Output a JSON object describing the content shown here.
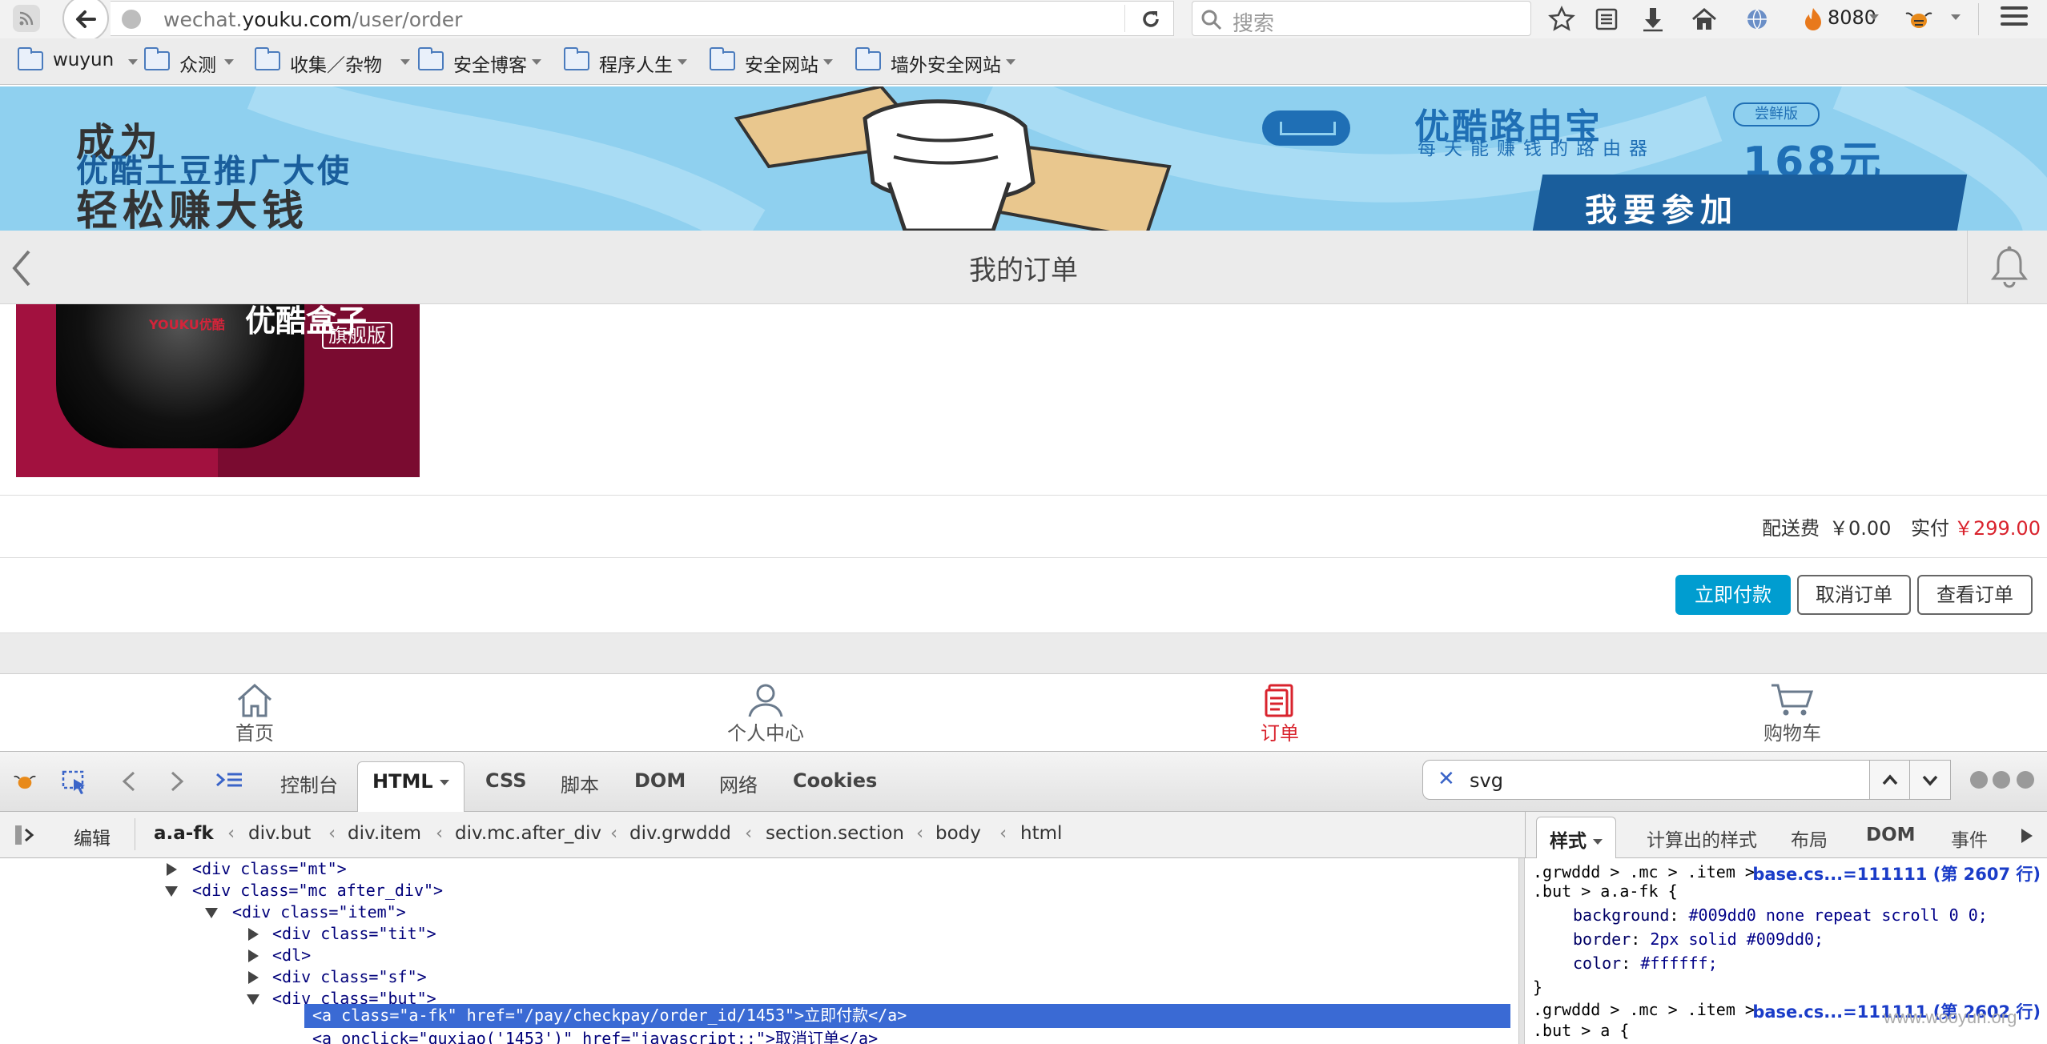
{
  "browser": {
    "url_domain": "wechat.",
    "url_host": "youku.com",
    "url_path": "/user/order",
    "search_placeholder": "搜索",
    "proxy_port": "8080"
  },
  "bookmarks": [
    {
      "label": "wuyun"
    },
    {
      "label": "众测"
    },
    {
      "label": "收集／杂物"
    },
    {
      "label": "安全博客"
    },
    {
      "label": "程序人生"
    },
    {
      "label": "安全网站"
    },
    {
      "label": "墙外安全网站"
    }
  ],
  "banner": {
    "line1": "成为",
    "line2": "优酷土豆推广大使",
    "line3": "轻松赚大钱",
    "right_title": "优酷路由宝",
    "right_tag": "尝鲜版",
    "right_sub": "每天能赚钱的路由器",
    "price": "168元",
    "cta": "我要参加"
  },
  "navbar": {
    "title": "我的订单"
  },
  "product": {
    "brand": "YOUKU优酷",
    "name": "优酷盒子",
    "badge": "旗舰版"
  },
  "order": {
    "shipping_label": "配送费",
    "shipping_value": "￥0.00",
    "paid_label": "实付",
    "paid_value": "￥299.00",
    "pay_button": "立即付款",
    "cancel_button": "取消订单",
    "view_button": "查看订单"
  },
  "tabbar": [
    {
      "label": "首页",
      "icon": "home-icon",
      "active": false
    },
    {
      "label": "个人中心",
      "icon": "user-icon",
      "active": false
    },
    {
      "label": "订单",
      "icon": "order-icon",
      "active": true
    },
    {
      "label": "购物车",
      "icon": "cart-icon",
      "active": false
    }
  ],
  "firebug": {
    "tabs": [
      "控制台",
      "HTML",
      "CSS",
      "脚本",
      "DOM",
      "网络",
      "Cookies"
    ],
    "active_tab": "HTML",
    "search_value": "svg",
    "edit_label": "编辑",
    "breadcrumbs": [
      "a.a-fk",
      "div.but",
      "div.item",
      "div.mc.after_div",
      "div.grwddd",
      "section.section",
      "body",
      "html"
    ],
    "side_tabs": [
      "样式",
      "计算出的样式",
      "布局",
      "DOM",
      "事件"
    ],
    "active_side_tab": "样式",
    "html_lines": [
      {
        "text": "<div class=\"mt\">"
      },
      {
        "text": "<div class=\"mc after_div\">"
      },
      {
        "text": "<div class=\"item\">"
      },
      {
        "text": "<div class=\"tit\">"
      },
      {
        "text": "<dl>"
      },
      {
        "text": "<div class=\"sf\">"
      },
      {
        "text": "<div class=\"but\">"
      },
      {
        "text": "<a class=\"a-fk\" href=\"/pay/checkpay/order_id/1453\">立即付款</a>"
      },
      {
        "text": "<a onclick=\"quxiao('1453')\" href=\"javascript:;\">取消订单</a>"
      }
    ],
    "style_rules": [
      {
        "selector1": ".grwddd > .mc > .item >",
        "selector2": ".but > a.a-fk {",
        "source": "base.cs...=111111 (第 2607 行)",
        "props": [
          {
            "name": "background",
            "value": "#009dd0 none repeat scroll 0 0;"
          },
          {
            "name": "border",
            "value": "2px solid #009dd0;"
          },
          {
            "name": "color",
            "value": "#ffffff;"
          }
        ],
        "close": "}"
      },
      {
        "selector1": ".grwddd > .mc > .item >",
        "selector2": ".but > a {",
        "source": "base.cs...=111111 (第 2602 行)"
      }
    ]
  },
  "watermark": "www.wooyun.org",
  "colors": {
    "accent": "#009dd0",
    "price_red": "#d9232d",
    "banner_bg": "#8fd0ef",
    "selection": "#3a6ad4"
  }
}
